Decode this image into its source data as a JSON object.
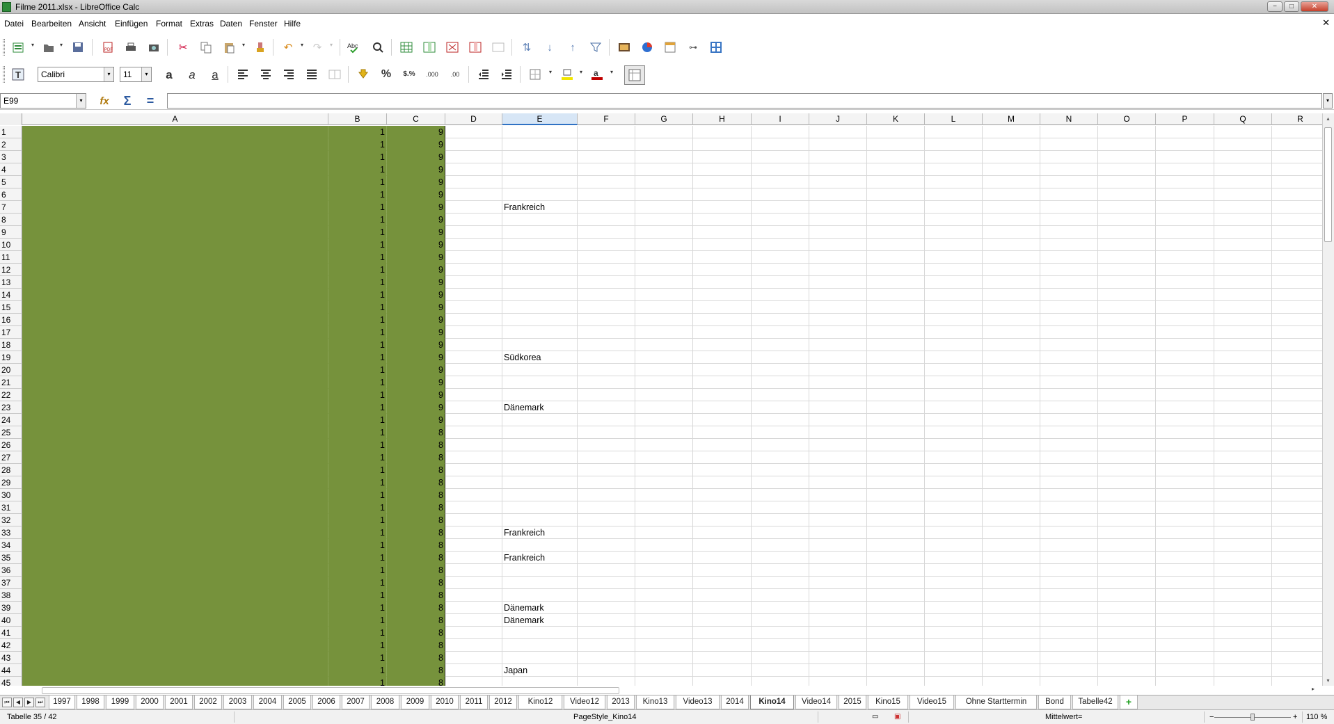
{
  "window": {
    "title": "Filme 2011.xlsx - LibreOffice Calc",
    "min": "−",
    "max": "□",
    "close": "✕"
  },
  "menu": {
    "items": [
      "Datei",
      "Bearbeiten",
      "Ansicht",
      "Einfügen",
      "Format",
      "Extras",
      "Daten",
      "Fenster",
      "Hilfe"
    ],
    "doc_close": "✕"
  },
  "toolbar": {
    "standard_icons": [
      "new-icon",
      "open-icon",
      "save-icon",
      "export-pdf-icon",
      "print-icon",
      "print-preview-icon",
      "cut-icon",
      "copy-icon",
      "paste-icon",
      "clone-formatting-icon",
      "undo-icon",
      "redo-icon",
      "spellcheck-icon",
      "find-replace-icon",
      "row-icon",
      "column-icon",
      "delete-row-icon",
      "delete-column-icon",
      "merge-icon",
      "sort-icon",
      "sort-ascending-icon",
      "sort-descending-icon",
      "autofilter-icon",
      "image-icon",
      "chart-icon",
      "pivot-table-icon",
      "special-char-icon",
      "navigator-icon"
    ],
    "formatting_icons": [
      "styles-icon",
      "bold-icon",
      "italic-icon",
      "underline-icon",
      "align-left-icon",
      "align-center-icon",
      "align-right-icon",
      "justify-icon",
      "merge-center-icon",
      "currency-icon",
      "percent-icon",
      "number-format-icon",
      "add-decimal-icon",
      "delete-decimal-icon",
      "decrease-indent-icon",
      "increase-indent-icon",
      "borders-icon",
      "background-color-icon",
      "font-color-icon",
      "toggle-grid-icon"
    ],
    "font_name": "Calibri",
    "font_size": "11"
  },
  "formula_bar": {
    "name_box": "E99",
    "function_wizard": "fx",
    "sum": "Σ",
    "equals": "=",
    "content": ""
  },
  "grid": {
    "columns": [
      "A",
      "B",
      "C",
      "D",
      "E",
      "F",
      "G",
      "H",
      "I",
      "J",
      "K",
      "L",
      "M",
      "N",
      "O",
      "P",
      "Q",
      "R"
    ],
    "selected_column": "E",
    "rows": [
      {
        "n": "1",
        "b": "1",
        "c": "9",
        "e": ""
      },
      {
        "n": "2",
        "b": "1",
        "c": "9",
        "e": ""
      },
      {
        "n": "3",
        "b": "1",
        "c": "9",
        "e": ""
      },
      {
        "n": "4",
        "b": "1",
        "c": "9",
        "e": ""
      },
      {
        "n": "5",
        "b": "1",
        "c": "9",
        "e": ""
      },
      {
        "n": "6",
        "b": "1",
        "c": "9",
        "e": ""
      },
      {
        "n": "7",
        "b": "1",
        "c": "9",
        "e": "Frankreich"
      },
      {
        "n": "8",
        "b": "1",
        "c": "9",
        "e": ""
      },
      {
        "n": "9",
        "b": "1",
        "c": "9",
        "e": ""
      },
      {
        "n": "10",
        "b": "1",
        "c": "9",
        "e": ""
      },
      {
        "n": "11",
        "b": "1",
        "c": "9",
        "e": ""
      },
      {
        "n": "12",
        "b": "1",
        "c": "9",
        "e": ""
      },
      {
        "n": "13",
        "b": "1",
        "c": "9",
        "e": ""
      },
      {
        "n": "14",
        "b": "1",
        "c": "9",
        "e": ""
      },
      {
        "n": "15",
        "b": "1",
        "c": "9",
        "e": ""
      },
      {
        "n": "16",
        "b": "1",
        "c": "9",
        "e": ""
      },
      {
        "n": "17",
        "b": "1",
        "c": "9",
        "e": ""
      },
      {
        "n": "18",
        "b": "1",
        "c": "9",
        "e": ""
      },
      {
        "n": "19",
        "b": "1",
        "c": "9",
        "e": "Südkorea"
      },
      {
        "n": "20",
        "b": "1",
        "c": "9",
        "e": ""
      },
      {
        "n": "21",
        "b": "1",
        "c": "9",
        "e": ""
      },
      {
        "n": "22",
        "b": "1",
        "c": "9",
        "e": ""
      },
      {
        "n": "23",
        "b": "1",
        "c": "9",
        "e": "Dänemark"
      },
      {
        "n": "24",
        "b": "1",
        "c": "9",
        "e": ""
      },
      {
        "n": "25",
        "b": "1",
        "c": "8",
        "e": ""
      },
      {
        "n": "26",
        "b": "1",
        "c": "8",
        "e": ""
      },
      {
        "n": "27",
        "b": "1",
        "c": "8",
        "e": ""
      },
      {
        "n": "28",
        "b": "1",
        "c": "8",
        "e": ""
      },
      {
        "n": "29",
        "b": "1",
        "c": "8",
        "e": ""
      },
      {
        "n": "30",
        "b": "1",
        "c": "8",
        "e": ""
      },
      {
        "n": "31",
        "b": "1",
        "c": "8",
        "e": ""
      },
      {
        "n": "32",
        "b": "1",
        "c": "8",
        "e": ""
      },
      {
        "n": "33",
        "b": "1",
        "c": "8",
        "e": "Frankreich"
      },
      {
        "n": "34",
        "b": "1",
        "c": "8",
        "e": ""
      },
      {
        "n": "35",
        "b": "1",
        "c": "8",
        "e": "Frankreich"
      },
      {
        "n": "36",
        "b": "1",
        "c": "8",
        "e": ""
      },
      {
        "n": "37",
        "b": "1",
        "c": "8",
        "e": ""
      },
      {
        "n": "38",
        "b": "1",
        "c": "8",
        "e": ""
      },
      {
        "n": "39",
        "b": "1",
        "c": "8",
        "e": "Dänemark"
      },
      {
        "n": "40",
        "b": "1",
        "c": "8",
        "e": "Dänemark"
      },
      {
        "n": "41",
        "b": "1",
        "c": "8",
        "e": ""
      },
      {
        "n": "42",
        "b": "1",
        "c": "8",
        "e": ""
      },
      {
        "n": "43",
        "b": "1",
        "c": "8",
        "e": ""
      },
      {
        "n": "44",
        "b": "1",
        "c": "8",
        "e": "Japan"
      },
      {
        "n": "45",
        "b": "1",
        "c": "8",
        "e": ""
      }
    ],
    "fill_color": "#76923c"
  },
  "sheet_tabs": {
    "nav": [
      "⏮",
      "◀",
      "▶",
      "⏭"
    ],
    "tabs": [
      "1997",
      "1998",
      "1999",
      "2000",
      "2001",
      "2002",
      "2003",
      "2004",
      "2005",
      "2006",
      "2007",
      "2008",
      "2009",
      "2010",
      "2011",
      "2012",
      "Kino12",
      "Video12",
      "2013",
      "Kino13",
      "Video13",
      "2014",
      "Kino14",
      "Video14",
      "2015",
      "Kino15",
      "Video15",
      "Ohne Starttermin",
      "Bond",
      "Tabelle42"
    ],
    "active": "Kino14",
    "add": "+"
  },
  "status": {
    "sheet": "Tabelle 35 / 42",
    "page_style": "PageStyle_Kino14",
    "sum_label": "Mittelwert=",
    "zoom": "110 %",
    "zoom_minus": "−",
    "zoom_plus": "+"
  }
}
